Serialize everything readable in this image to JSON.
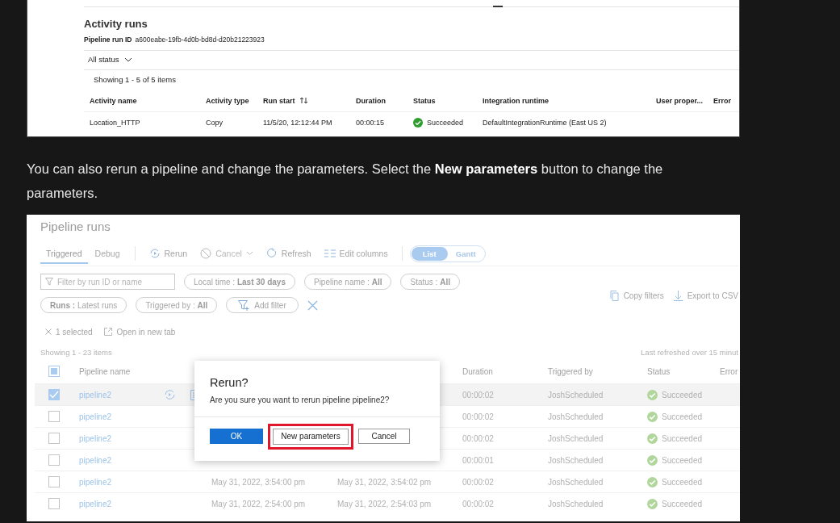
{
  "activity_screenshot": {
    "title": "Activity runs",
    "run_id_label": "Pipeline run ID",
    "run_id": "a600eabe-19fb-4d0b-bd8d-d20b21223923",
    "status_filter": "All status",
    "showing": "Showing 1 - 5 of 5 items",
    "columns": [
      "Activity name",
      "Activity type",
      "Run start",
      "Duration",
      "Status",
      "Integration runtime",
      "User proper...",
      "Error"
    ],
    "rows": [
      {
        "name": "Location_HTTP",
        "type": "Copy",
        "run_start": "11/5/20, 12:12:44 PM",
        "duration": "00:00:15",
        "status": "Succeeded",
        "runtime": "DefaultIntegrationRuntime (East US 2)"
      }
    ]
  },
  "paragraph": "You can also rerun a pipeline and change the parameters. Select the **New parameters** button to change the parameters.",
  "pipeline_screenshot": {
    "title": "Pipeline runs",
    "tabs": [
      {
        "label": "Triggered",
        "selected": true
      },
      {
        "label": "Debug",
        "selected": false
      }
    ],
    "toolbar": [
      {
        "label": "Rerun",
        "disabled": false
      },
      {
        "label": "Cancel",
        "disabled": true
      },
      {
        "label": "Refresh",
        "disabled": false
      },
      {
        "label": "Edit columns",
        "disabled": false
      }
    ],
    "view_toggle": [
      {
        "label": "List",
        "selected": true
      },
      {
        "label": "Gantt",
        "selected": false
      }
    ],
    "filter_placeholder": "Filter by run ID or name",
    "filters_row1": [
      "Local time : **Last 30 days**",
      "Pipeline name : **All**",
      "Status : **All**"
    ],
    "filters_row2": [
      "**Runs :** Latest runs",
      "Triggered by : **All**"
    ],
    "add_filter": "Add filter",
    "copy_filters": "Copy filters",
    "export": "Export to CSV",
    "selected_count": "1 selected",
    "open_new_tab": "Open in new tab",
    "showing": "Showing 1 - 23 items",
    "last_refreshed": "Last refreshed over 15 minut",
    "columns": [
      "Pipeline name",
      "Duration",
      "Triggered by",
      "Status",
      "Error"
    ],
    "rows": [
      {
        "name": "pipeline2",
        "selected": true,
        "duration": "00:00:02",
        "triggered_by": "JoshScheduled",
        "status": "Succeeded"
      },
      {
        "name": "pipeline2",
        "selected": false,
        "duration": "00:00:02",
        "triggered_by": "JoshScheduled",
        "status": "Succeeded"
      },
      {
        "name": "pipeline2",
        "selected": false,
        "duration": "00:00:02",
        "triggered_by": "JoshScheduled",
        "status": "Succeeded"
      },
      {
        "name": "pipeline2",
        "selected": false,
        "duration": "00:00:01",
        "triggered_by": "JoshScheduled",
        "status": "Succeeded"
      },
      {
        "name": "pipeline2",
        "selected": false,
        "run_start": "May 31, 2022, 3:54:00 pm",
        "run_end": "May 31, 2022, 3:54:02 pm",
        "duration": "00:00:02",
        "triggered_by": "JoshScheduled",
        "status": "Succeeded"
      },
      {
        "name": "pipeline2",
        "selected": false,
        "run_start": "May 31, 2022, 2:54:00 pm",
        "run_end": "May 31, 2022, 2:54:03 pm",
        "duration": "00:00:02",
        "triggered_by": "JoshScheduled",
        "status": "Succeeded"
      }
    ],
    "dialog": {
      "title": "Rerun?",
      "message": "Are you sure you want to rerun pipeline pipeline2?",
      "buttons": [
        {
          "label": "OK",
          "kind": "primary",
          "highlighted": false
        },
        {
          "label": "New parameters",
          "kind": "default",
          "highlighted": true
        },
        {
          "label": "Cancel",
          "kind": "default",
          "highlighted": false
        }
      ]
    }
  }
}
